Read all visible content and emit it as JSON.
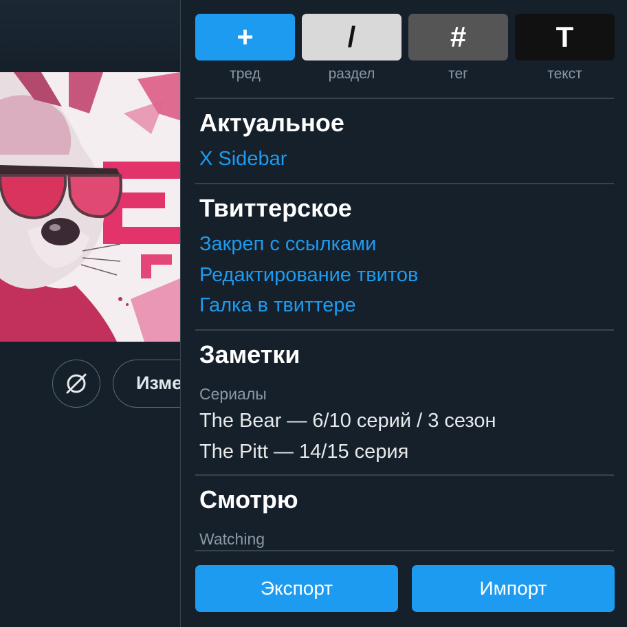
{
  "background": {
    "edit_button_partial": "Изме"
  },
  "toolbar": {
    "buttons": [
      {
        "glyph": "+",
        "label": "тред",
        "bg": "#1d9bf0",
        "fg": "#ffffff"
      },
      {
        "glyph": "/",
        "label": "раздел",
        "bg": "#d9d9d9",
        "fg": "#111111"
      },
      {
        "glyph": "#",
        "label": "тег",
        "bg": "#555555",
        "fg": "#ffffff"
      },
      {
        "glyph": "T",
        "label": "текст",
        "bg": "#111111",
        "fg": "#ffffff"
      }
    ]
  },
  "sections": {
    "actual": {
      "title": "Актуальное",
      "links": [
        "X Sidebar"
      ]
    },
    "twitter": {
      "title": "Твиттерское",
      "links": [
        "Закреп с ссылками",
        "Редактирование твитов",
        "Галка в твиттере"
      ]
    },
    "notes": {
      "title": "Заметки",
      "subtitle": "Сериалы",
      "lines": [
        "The Bear — 6/10 серий / 3 сезон",
        "The Pitt — 14/15 серия"
      ]
    },
    "watching": {
      "title": "Смотрю",
      "subtitle": "Watching"
    }
  },
  "footer": {
    "export_label": "Экспорт",
    "import_label": "Импорт"
  },
  "colors": {
    "accent": "#1d9bf0",
    "background": "#15202b",
    "divider": "#38444d",
    "muted_text": "#8b98a5"
  }
}
